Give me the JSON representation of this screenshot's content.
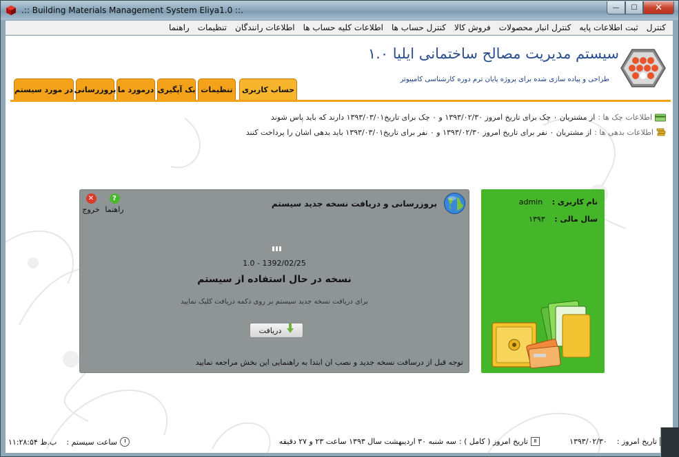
{
  "window": {
    "title": ".:: Building Materials Management System Eliya1.0 ::.",
    "min_glyph": "—",
    "max_glyph": "☐",
    "close_glyph": "✕"
  },
  "menu": [
    "کنترل",
    "ثبت اطلاعات پایه",
    "کنترل انبار محصولات",
    "فروش کالا",
    "کنترل حساب ها",
    "اطلاعات کلیه حساب ها",
    "اطلاعات رانندگان",
    "تنظیمات",
    "راهنما"
  ],
  "header": {
    "title": "سیستم مدیریت مصالح ساختمانی ایلیا ۱.۰",
    "subtitle": "طراحی و پیاده سازی شده برای پروژه پایان ترم دوره کارشناسی کامپیوتر"
  },
  "tabs": [
    "حساب کاربری",
    "تنظیمات",
    "بک آپگیری",
    "درمورد ما",
    "بروزرسانی",
    "در مورد سیستم"
  ],
  "info": {
    "cheques_label": "اطلاعات چک ها :",
    "cheques_text": "از مشتریان ۰ چک برای تاریخ امروز ۱۳۹۳/۰۲/۳۰ و ۰ چک برای تاریخ۱۳۹۳/۰۳/۰۱ دارند که باید پاس شوند",
    "debts_label": "اطلاعات بدهی ها :",
    "debts_text": "از مشتریان ۰ نفر برای تاریخ امروز ۱۳۹۳/۰۲/۳۰ و ۰ نفر برای تاریخ۱۳۹۳/۰۳/۰۱ باید بدهی اشان را پرداخت کنند"
  },
  "update_panel": {
    "title": "بروزرسانی و دریافت نسخه جدید سیستم",
    "help_label": "راهنما",
    "exit_label": "خروج",
    "version": "1.0 - 1392/02/25",
    "version_label": "نسخه در حال استفاده از سیستم",
    "instruction": "برای دریافت نسخه جدید سیستم بر روی دکمه دریافت کلیک نمایید",
    "download_label": "دریافت",
    "note": "توجه قبل از درسافت نسخه جدید و نصب ان ابتدا به راهنمایی این بخش مراجعه نمایید"
  },
  "user_panel": {
    "username_label": "نام کاربری :",
    "username": "admin",
    "fiscal_year_label": "سال مالی :",
    "fiscal_year": "۱۳۹۳"
  },
  "status": {
    "today_label": "تاریخ امروز :",
    "today": "۱۳۹۳/۰۲/۳۰",
    "today_full_label": "تاریخ امروز ( کامل ) :",
    "today_full": "سه شنبه ۳۰ اردیبهشت سال ۱۳۹۳ ساعت ۲۳ و ۲۷ دقیقه",
    "clock_label": "ساعت سیستم :",
    "clock": "ب.ظ ۱۱:۲۸:۵۴",
    "calendar_day": "8"
  },
  "colors": {
    "accent_orange": "#f3a21a",
    "title_blue": "#2a4e8f",
    "panel_grey": "#8f9495",
    "panel_green": "#45b52a"
  }
}
